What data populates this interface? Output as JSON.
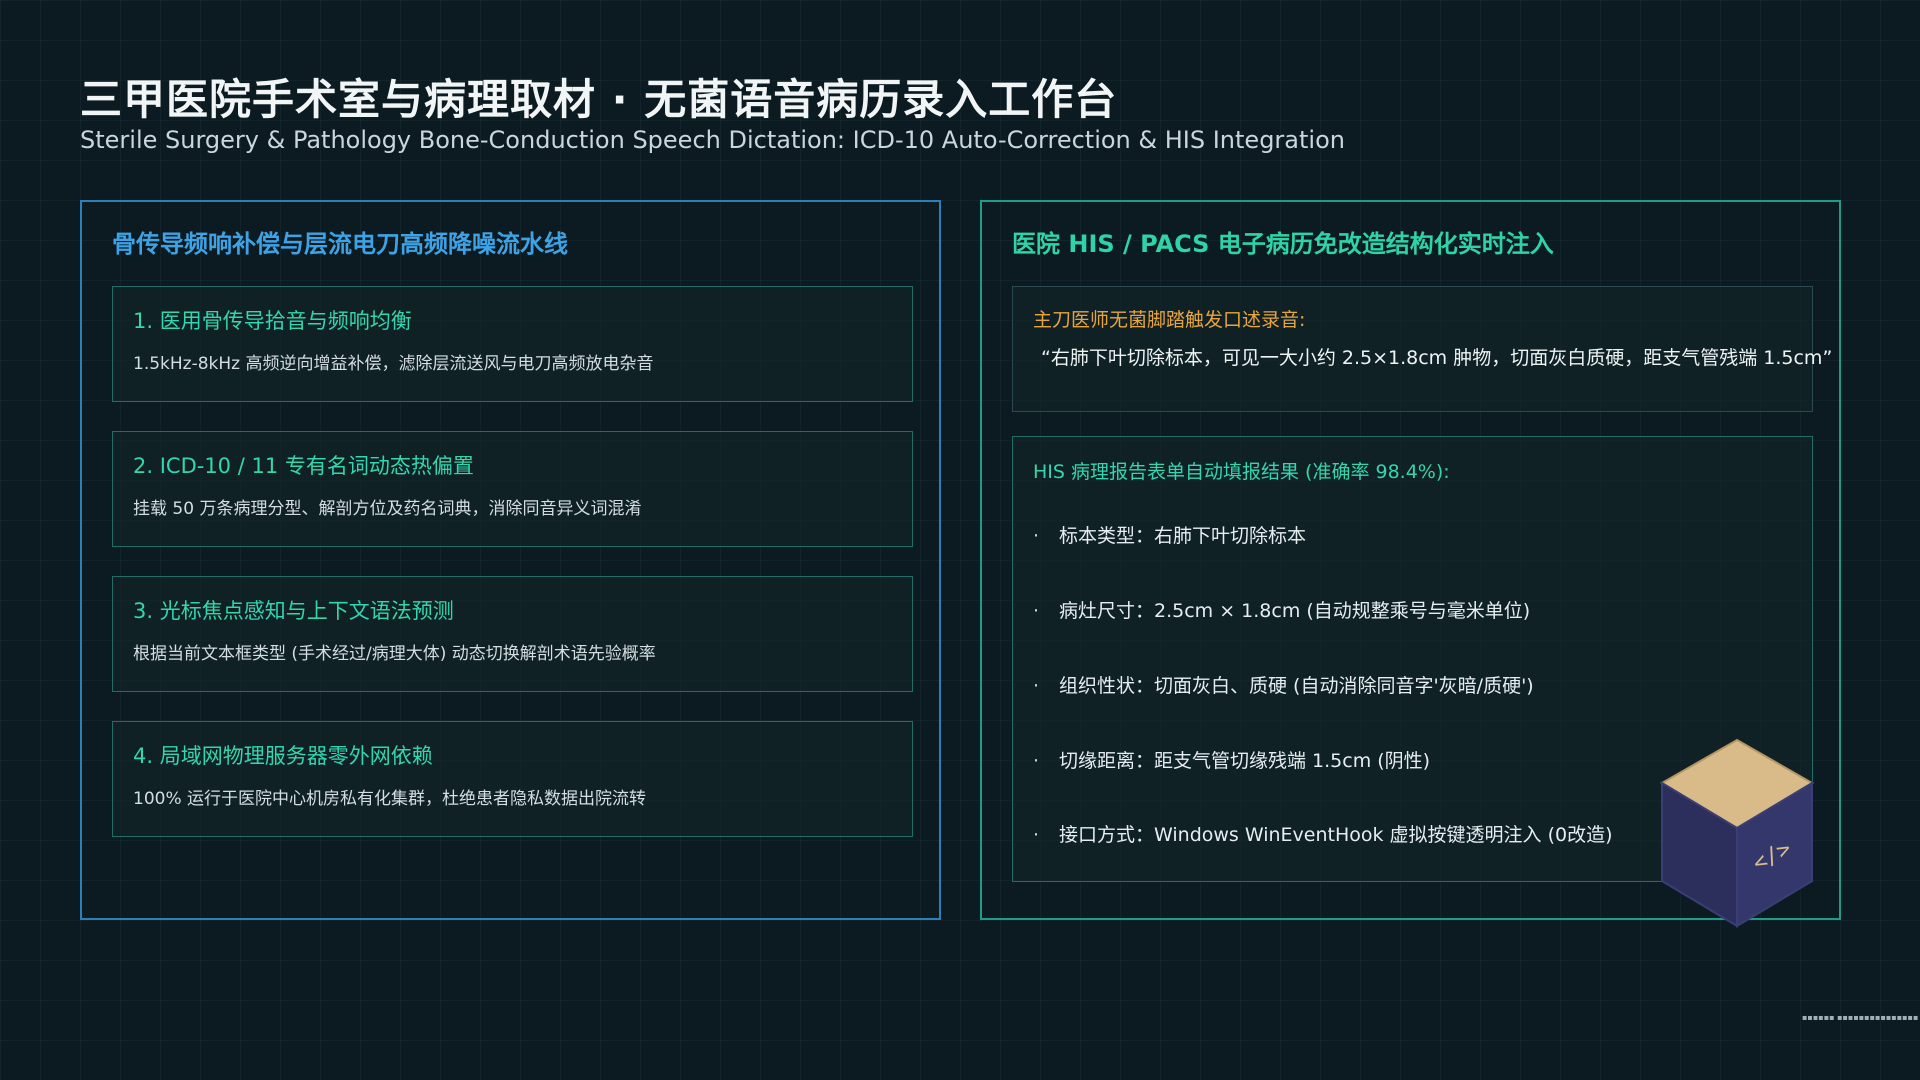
{
  "header": {
    "title": "三甲医院手术室与病理取材 ·  无菌语音病历录入工作台",
    "subtitle": "Sterile Surgery & Pathology Bone-Conduction Speech Dictation: ICD-10 Auto-Correction & HIS Integration"
  },
  "left_panel": {
    "title": "骨传导频响补偿与层流电刀高频降噪流水线",
    "steps": [
      {
        "title": "1. 医用骨传导拾音与频响均衡",
        "desc": "1.5kHz-8kHz 高频逆向增益补偿，滤除层流送风与电刀高频放电杂音"
      },
      {
        "title": "2. ICD-10 / 11 专有名词动态热偏置",
        "desc": "挂载 50 万条病理分型、解剖方位及药名词典，消除同音异义词混淆"
      },
      {
        "title": "3. 光标焦点感知与上下文语法预测",
        "desc": "根据当前文本框类型 (手术经过/病理大体) 动态切换解剖术语先验概率"
      },
      {
        "title": "4. 局域网物理服务器零外网依赖",
        "desc": "100% 运行于医院中心机房私有化集群，杜绝患者隐私数据出院流转"
      }
    ]
  },
  "right_panel": {
    "title": "医院 HIS / PACS 电子病历免改造结构化实时注入",
    "voice": {
      "label": "主刀医师无菌脚踏触发口述录音:",
      "quote": "“右肺下叶切除标本，可见一大小约 2.5×1.8cm 肿物，切面灰白质硬，距支气管残端 1.5cm”"
    },
    "result": {
      "title": "HIS 病理报告表单自动填报结果 (准确率 98.4%):",
      "bullet": "·",
      "items": [
        "标本类型：右肺下叶切除标本",
        "病灶尺寸：2.5cm × 1.8cm (自动规整乘号与毫米单位)",
        "组织性状：切面灰白、质硬 (自动消除同音字'灰暗/质硬')",
        "切缘距离：距支气管切缘残端 1.5cm (阴性)",
        "接口方式：Windows WinEventHook 虚拟按键透明注入 (0改造)"
      ]
    }
  },
  "footer": {
    "note": "▪▪▪▪▪▪ ▪▪▪▪▪▪▪▪▪▪▪▪▪▪▪"
  },
  "colors": {
    "accent_blue": "#3ea3e6",
    "accent_green": "#33d6ae",
    "accent_orange": "#e8a53c"
  }
}
